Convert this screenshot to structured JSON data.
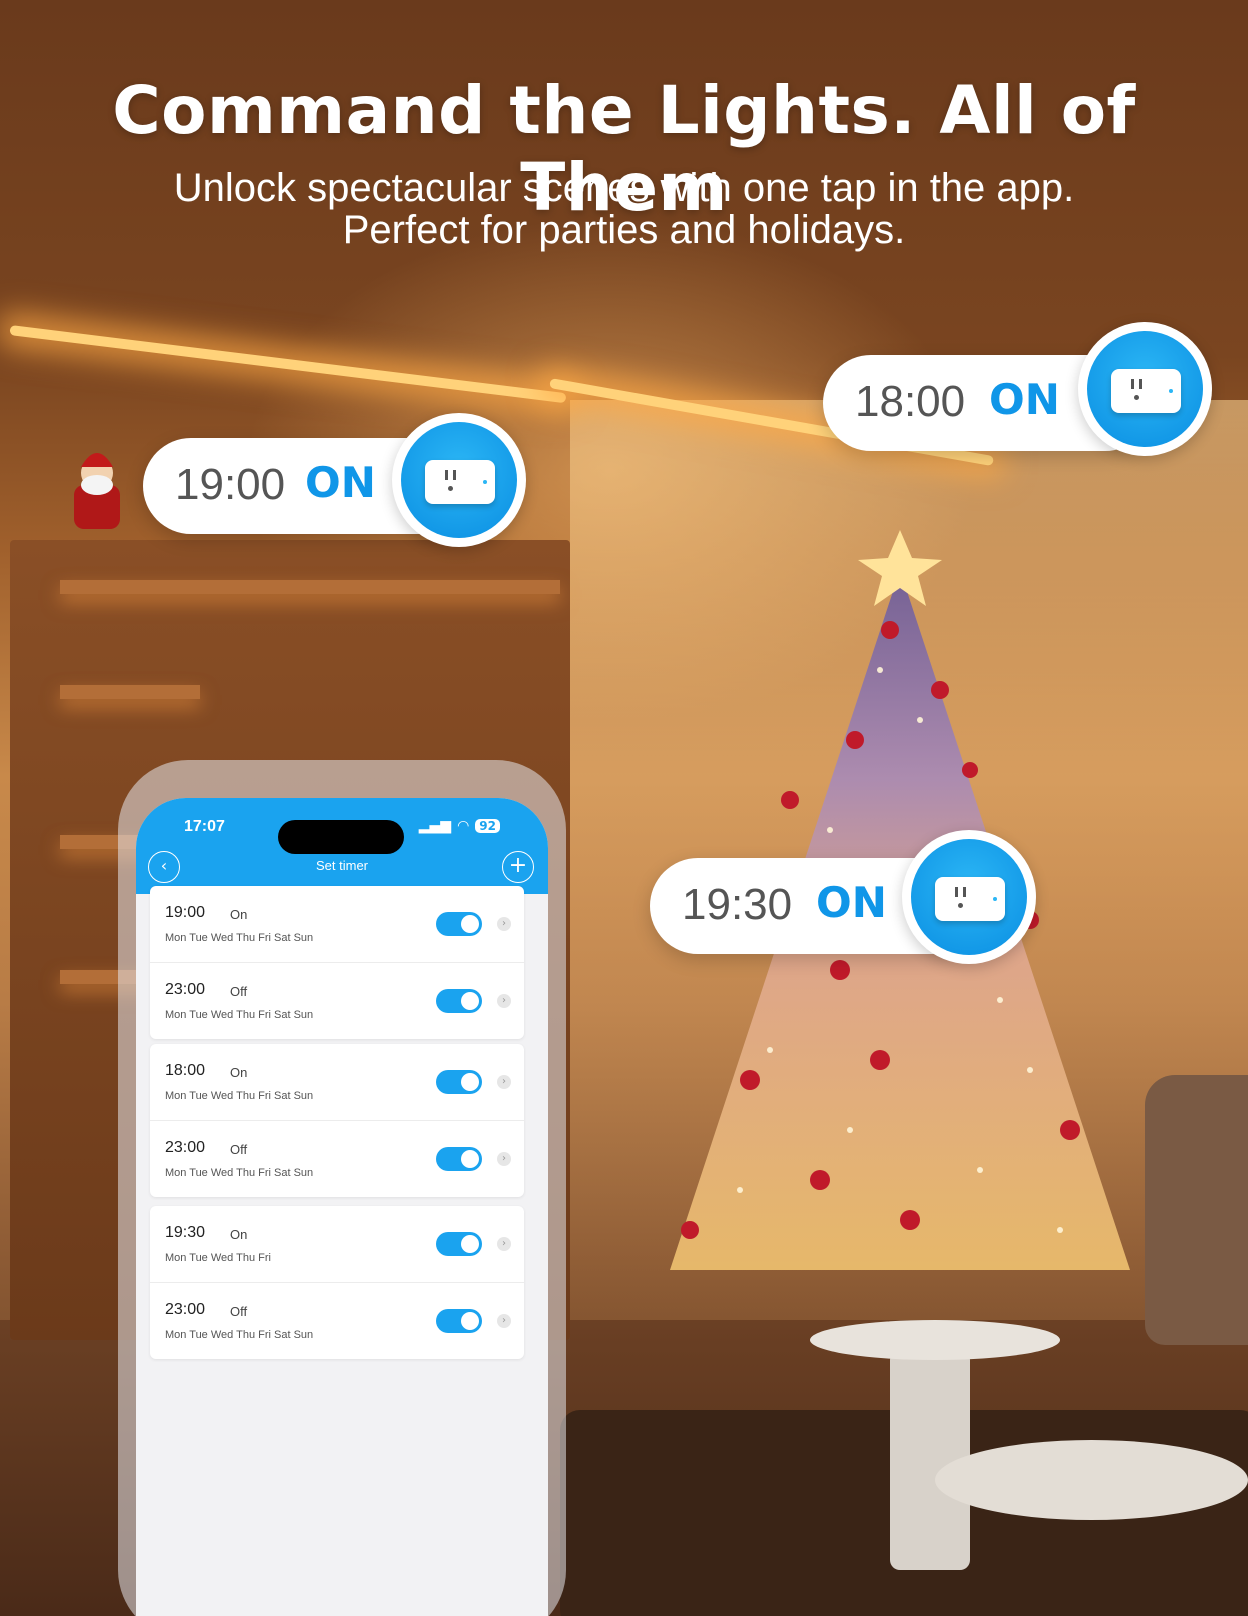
{
  "headline": {
    "title": "Command the Lights. All of Them",
    "subtitle_line1": "Unlock spectacular scenes with one tap in the app.",
    "subtitle_line2": "Perfect for parties and holidays."
  },
  "callouts": [
    {
      "time": "19:00",
      "state": "ON"
    },
    {
      "time": "18:00",
      "state": "ON"
    },
    {
      "time": "19:30",
      "state": "ON"
    }
  ],
  "colors": {
    "accent": "#1aa3ef",
    "callout_text": "#1096e8"
  },
  "phone": {
    "status_time": "17:07",
    "battery": "92",
    "app_title": "Set timer",
    "timer_groups": [
      [
        {
          "time": "19:00",
          "state": "On",
          "days": "Mon Tue Wed Thu Fri Sat Sun",
          "enabled": true
        },
        {
          "time": "23:00",
          "state": "Off",
          "days": "Mon Tue Wed Thu Fri Sat Sun",
          "enabled": true
        }
      ],
      [
        {
          "time": "18:00",
          "state": "On",
          "days": "Mon Tue Wed Thu Fri Sat Sun",
          "enabled": true
        },
        {
          "time": "23:00",
          "state": "Off",
          "days": "Mon Tue Wed Thu Fri Sat Sun",
          "enabled": true
        }
      ],
      [
        {
          "time": "19:30",
          "state": "On",
          "days": "Mon Tue Wed Thu Fri",
          "enabled": true
        },
        {
          "time": "23:00",
          "state": "Off",
          "days": "Mon Tue Wed Thu Fri Sat Sun",
          "enabled": true
        }
      ]
    ]
  }
}
